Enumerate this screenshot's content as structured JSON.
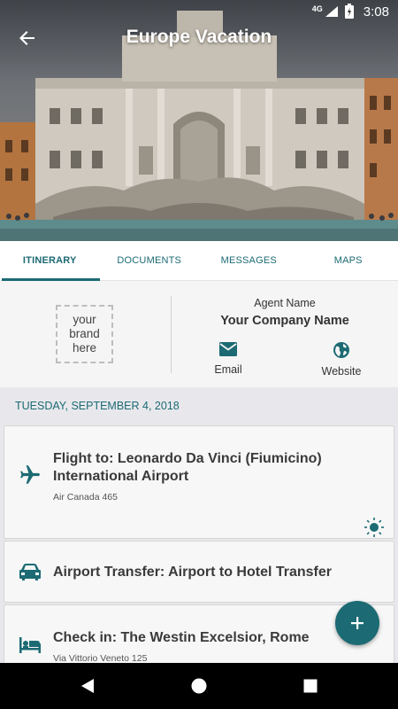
{
  "status_bar": {
    "network": "4G",
    "time": "3:08"
  },
  "app_bar": {
    "title": "Europe Vacation"
  },
  "tabs": [
    {
      "label": "ITINERARY",
      "active": true
    },
    {
      "label": "DOCUMENTS",
      "active": false
    },
    {
      "label": "MESSAGES",
      "active": false
    },
    {
      "label": "MAPS",
      "active": false
    }
  ],
  "agent": {
    "brand_placeholder": [
      "your",
      "brand",
      "here"
    ],
    "agent_name": "Agent Name",
    "company_name": "Your Company Name",
    "email_label": "Email",
    "website_label": "Website"
  },
  "itinerary": {
    "date": "TUESDAY, SEPTEMBER 4, 2018",
    "items": [
      {
        "icon": "airplane-icon",
        "title": "Flight to: Leonardo Da Vinci (Fiumicino) International Airport",
        "subtitle": "Air Canada 465",
        "badge_icon": "sun-icon"
      },
      {
        "icon": "car-icon",
        "title": "Airport Transfer: Airport to Hotel Transfer",
        "subtitle": ""
      },
      {
        "icon": "hotel-bed-icon",
        "title": "Check in: The Westin Excelsior, Rome",
        "subtitle": "Via Vittorio Veneto 125"
      }
    ]
  },
  "fab": {
    "icon": "plus-icon"
  },
  "colors": {
    "accent": "#1c6a73",
    "card_bg": "#f7f7f7",
    "list_bg": "#e8e8ec"
  }
}
